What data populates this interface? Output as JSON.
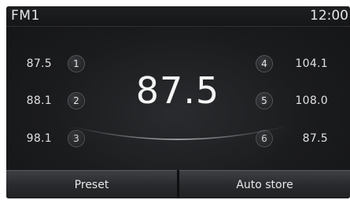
{
  "header": {
    "band": "FM1",
    "time": "12:00"
  },
  "current_frequency": "87.5",
  "presets_left": [
    {
      "num": "1",
      "freq": "87.5"
    },
    {
      "num": "2",
      "freq": "88.1"
    },
    {
      "num": "3",
      "freq": "98.1"
    }
  ],
  "presets_right": [
    {
      "num": "4",
      "freq": "104.1"
    },
    {
      "num": "5",
      "freq": "108.0"
    },
    {
      "num": "6",
      "freq": "87.5"
    }
  ],
  "buttons": {
    "preset": "Preset",
    "auto_store": "Auto store"
  },
  "colors": {
    "background": "#1a1b1d",
    "text": "#e6e6e6",
    "glow": "#8a8c90"
  }
}
